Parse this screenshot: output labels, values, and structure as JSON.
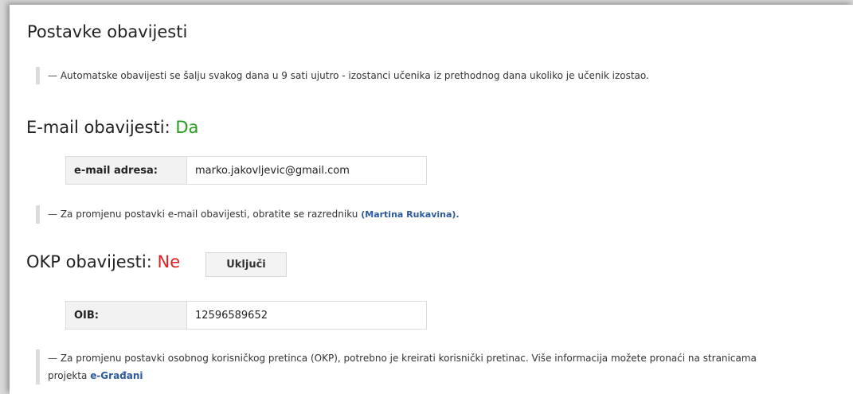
{
  "page": {
    "title": "Postavke obavijesti"
  },
  "info_note": {
    "dash": "—",
    "text": "Automatske obavijesti se šalju svakog dana u 9 sati ujutro - izostanci učenika iz prethodnog dana ukoliko je učenik izostao."
  },
  "email_section": {
    "heading": "E-mail obavijesti:",
    "status": "Da",
    "status_color": "#2a9b1f",
    "field_label": "e-mail adresa:",
    "field_value": "marko.jakovljevic@gmail.com",
    "note_text": "Za promjenu postavki e-mail obavijesti, obratite se razredniku",
    "note_link": "(Martina Rukavina)."
  },
  "okp_section": {
    "heading": "OKP obavijesti:",
    "status": "Ne",
    "status_color": "#e02020",
    "button_label": "Uključi",
    "field_label": "OIB:",
    "field_value": "12596589652",
    "note_text_line1": "Za promjenu postavki osobnog korisničkog pretinca (OKP), potrebno je kreirati korisnički pretinac. Više informacija možete pronaći na stranicama",
    "note_text_line2": "projekta",
    "note_link": "e-Građani"
  }
}
